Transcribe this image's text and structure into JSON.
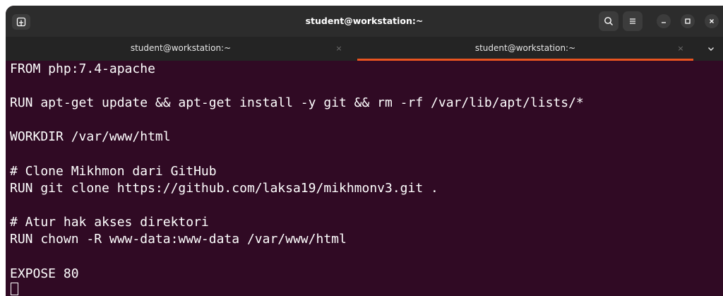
{
  "window": {
    "title": "student@workstation:~"
  },
  "tabs": [
    {
      "label": "student@workstation:~",
      "active": false,
      "close": "×"
    },
    {
      "label": "student@workstation:~",
      "active": true,
      "close": "×"
    }
  ],
  "terminal": {
    "lines": [
      "FROM php:7.4-apache",
      "",
      "RUN apt-get update && apt-get install -y git && rm -rf /var/lib/apt/lists/*",
      "",
      "WORKDIR /var/www/html",
      "",
      "# Clone Mikhmon dari GitHub",
      "RUN git clone https://github.com/laksa19/mikhmonv3.git .",
      "",
      "# Atur hak akses direktori",
      "RUN chown -R www-data:www-data /var/www/html",
      "",
      "EXPOSE 80"
    ]
  },
  "colors": {
    "terminal_bg": "#300a24",
    "titlebar_bg": "#2c2c2c",
    "tabbar_bg": "#242424",
    "accent": "#e95420",
    "text": "#ffffff"
  },
  "icons": {
    "new_tab": "new-tab-icon",
    "search": "search-icon",
    "menu": "hamburger-menu-icon",
    "minimize": "minimize-icon",
    "maximize": "maximize-icon",
    "close": "close-icon",
    "tab_list": "chevron-down-icon"
  }
}
